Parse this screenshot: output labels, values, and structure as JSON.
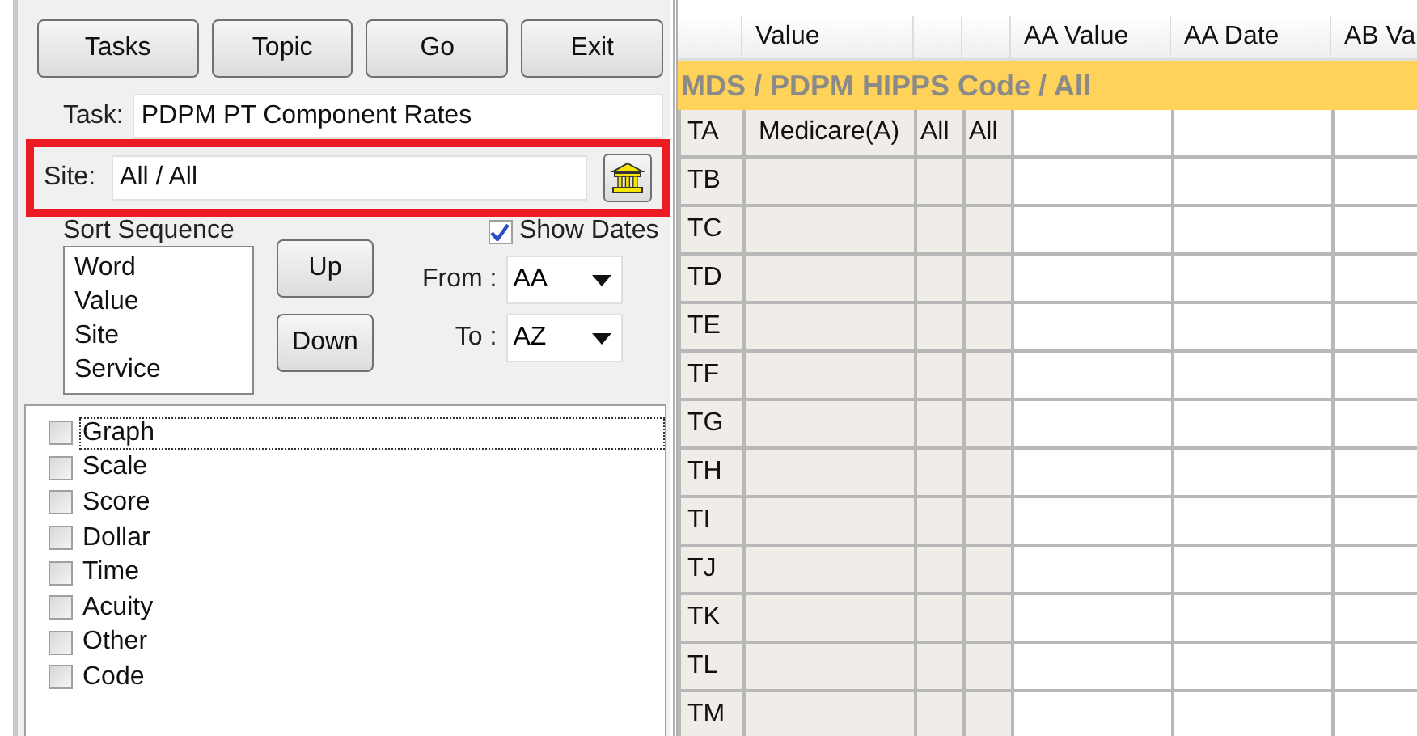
{
  "toolbar": {
    "buttons": [
      "Tasks",
      "Topic",
      "Go",
      "Exit"
    ]
  },
  "task": {
    "label": "Task:",
    "value": "PDPM PT Component Rates"
  },
  "site": {
    "label": "Site:",
    "value": "All / All",
    "highlighted": true
  },
  "sort_sequence": {
    "label": "Sort Sequence",
    "items": [
      "Word",
      "Value",
      "Site",
      "Service"
    ],
    "buttons": [
      "Up",
      "Down"
    ]
  },
  "show_dates": {
    "label": "Show Dates",
    "checked": true
  },
  "from": {
    "label": "From :",
    "value": "AA"
  },
  "to": {
    "label": "To :",
    "value": "AZ"
  },
  "checklist": [
    {
      "label": "Graph",
      "checked": false,
      "focused": true
    },
    {
      "label": "Scale",
      "checked": false,
      "focused": false
    },
    {
      "label": "Score",
      "checked": false,
      "focused": false
    },
    {
      "label": "Dollar",
      "checked": false,
      "focused": false
    },
    {
      "label": "Time",
      "checked": false,
      "focused": false
    },
    {
      "label": "Acuity",
      "checked": false,
      "focused": false
    },
    {
      "label": "Other",
      "checked": false,
      "focused": false
    },
    {
      "label": "Code",
      "checked": false,
      "focused": false
    }
  ],
  "grid": {
    "columns": [
      {
        "kind": "row-header"
      },
      {
        "kind": "wide",
        "label": "Value"
      },
      {
        "kind": "narrow"
      },
      {
        "kind": "narrow"
      },
      {
        "kind": "data",
        "label": "AA Value"
      },
      {
        "kind": "data",
        "label": "AA Date"
      },
      {
        "kind": "data",
        "label": "AB Va"
      }
    ],
    "group": "MDS / PDPM HIPPS Code / All",
    "rows": [
      {
        "label": "TA",
        "cells": [
          "Medicare(A)",
          "All",
          "All"
        ]
      },
      {
        "label": "TB"
      },
      {
        "label": "TC"
      },
      {
        "label": "TD"
      },
      {
        "label": "TE"
      },
      {
        "label": "TF"
      },
      {
        "label": "TG"
      },
      {
        "label": "TH"
      },
      {
        "label": "TI"
      },
      {
        "label": "TJ"
      },
      {
        "label": "TK"
      },
      {
        "label": "TL"
      },
      {
        "label": "TM"
      }
    ]
  }
}
